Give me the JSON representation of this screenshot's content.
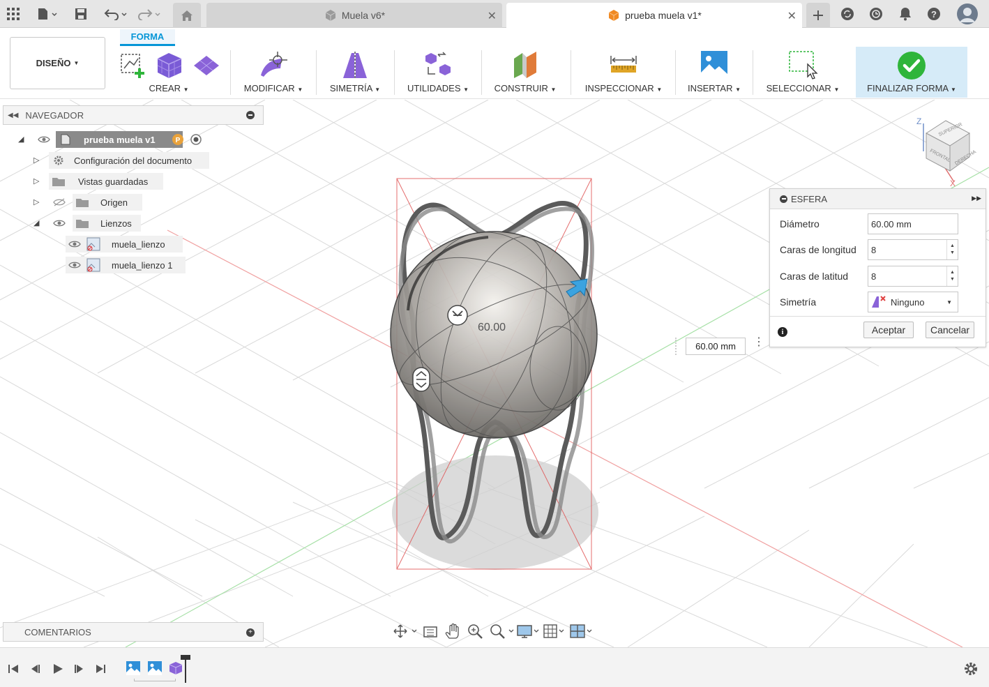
{
  "titlebar": {
    "tabs": [
      {
        "label": "Muela v6*",
        "active": false
      },
      {
        "label": "prueba muela v1*",
        "active": true
      }
    ]
  },
  "toolbar": {
    "workspace_label": "DISEÑO",
    "active_tab": "FORMA",
    "groups": [
      {
        "label": "CREAR"
      },
      {
        "label": "MODIFICAR"
      },
      {
        "label": "SIMETRÍA"
      },
      {
        "label": "UTILIDADES"
      },
      {
        "label": "CONSTRUIR"
      },
      {
        "label": "INSPECCIONAR"
      },
      {
        "label": "INSERTAR"
      },
      {
        "label": "SELECCIONAR"
      },
      {
        "label": "FINALIZAR FORMA"
      }
    ]
  },
  "navigator": {
    "title": "NAVEGADOR",
    "root": "prueba muela v1",
    "items": [
      {
        "label": "Configuración del documento"
      },
      {
        "label": "Vistas guardadas"
      },
      {
        "label": "Origen"
      },
      {
        "label": "Lienzos"
      },
      {
        "label": "muela_lienzo"
      },
      {
        "label": "muela_lienzo 1"
      }
    ]
  },
  "viewcube": {
    "faces": [
      "SUPERIOR",
      "FRONTAL",
      "DERECHA"
    ],
    "axis_z": "Z",
    "axis_x": "X"
  },
  "viewport": {
    "dimension_label": "60.00"
  },
  "inline_input": {
    "value": "60.00 mm"
  },
  "panel": {
    "title": "ESFERA",
    "rows": [
      {
        "label": "Diámetro",
        "value": "60.00 mm"
      },
      {
        "label": "Caras de longitud",
        "value": "8"
      },
      {
        "label": "Caras de latitud",
        "value": "8"
      },
      {
        "label": "Simetría",
        "value": "Ninguno"
      }
    ],
    "ok_label": "Aceptar",
    "cancel_label": "Cancelar"
  },
  "comments": {
    "title": "COMENTARIOS"
  },
  "colors": {
    "accent": "#0696d7",
    "finish_bg": "#d6ebf8",
    "check_green": "#2fb53b",
    "grid_red": "#e57373",
    "grid_green": "#7ccf7c"
  }
}
